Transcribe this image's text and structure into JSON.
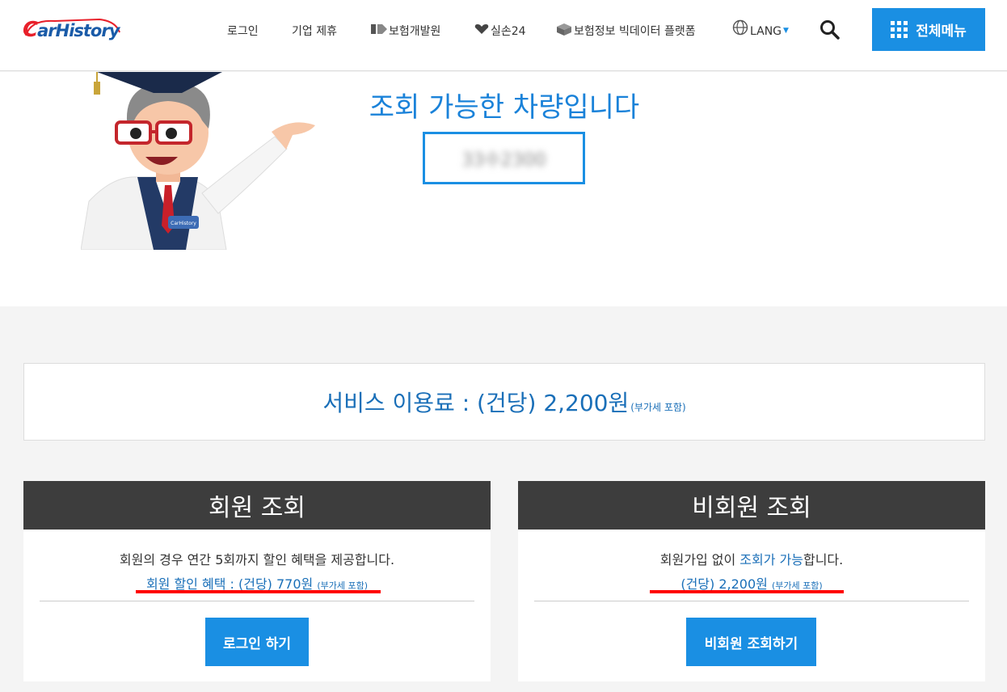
{
  "header": {
    "logo": "CarHistory",
    "nav": {
      "login": "로그인",
      "partner": "기업 제휴",
      "insurance_dev": "보험개발원",
      "silson": "실손24",
      "bigdata": "보험정보 빅데이터 플랫폼",
      "lang": "LANG"
    },
    "all_menu": "전체메뉴",
    "icons": [
      "search-icon",
      "globe-icon",
      "grid-icon"
    ],
    "accent": "#1a8fe3"
  },
  "hero": {
    "title": "조회 가능한 차량입니다",
    "plate": "33수2300"
  },
  "fee": {
    "main": "서비스 이용료 : (건당) 2,200원",
    "sub": "(부가세 포함)"
  },
  "member": {
    "title": "회원 조회",
    "desc": "회원의 경우 연간 5회까지 할인 혜택을 제공합니다.",
    "price": "회원 할인 혜택 : (건당) 770원",
    "price_note": "(부가세 포함)",
    "button": "로그인 하기"
  },
  "guest": {
    "title": "비회원 조회",
    "desc_prefix": "회원가입 없이 ",
    "desc_hl": "조회가 가능",
    "desc_suffix": "합니다.",
    "price": "(건당) 2,200원",
    "price_note": "(부가세 포함)",
    "button": "비회원 조회하기"
  }
}
